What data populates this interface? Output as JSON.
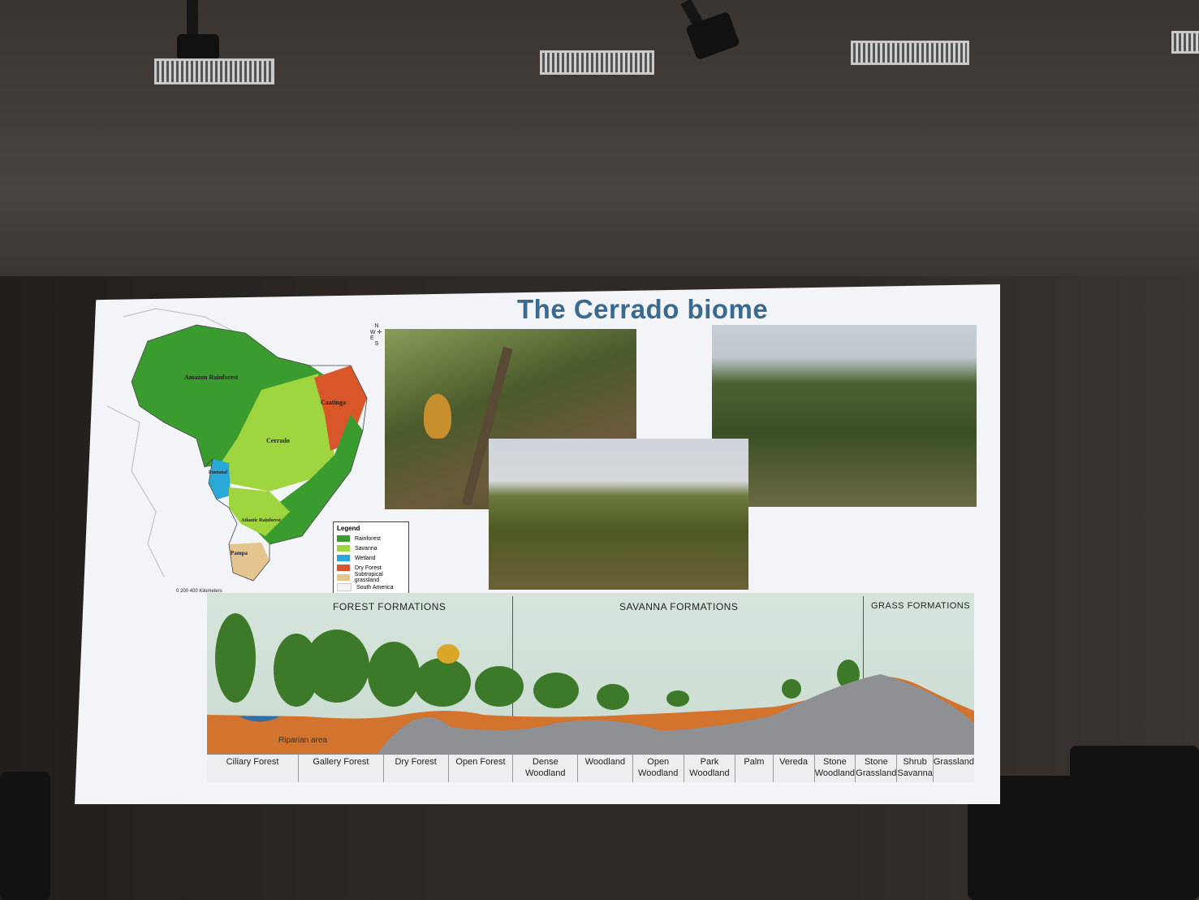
{
  "slide": {
    "title": "The Cerrado biome",
    "map": {
      "regions": [
        {
          "label": "Amazon Rainforest"
        },
        {
          "label": "Caatinga"
        },
        {
          "label": "Cerrado"
        },
        {
          "label": "Pantanal"
        },
        {
          "label": "Atlantic Rainforest"
        },
        {
          "label": "Pampa"
        }
      ],
      "compass": {
        "n": "N",
        "s": "S",
        "e": "E",
        "w": "W"
      },
      "scale": "0  200  400 Kilometers",
      "legend": {
        "title": "Legend",
        "items": [
          {
            "label": "Rainforest",
            "color": "#3a9b2e"
          },
          {
            "label": "Savanna",
            "color": "#9fd63f"
          },
          {
            "label": "Wetland",
            "color": "#2aa9d8"
          },
          {
            "label": "Dry Forest",
            "color": "#d9562a"
          },
          {
            "label": "Subtropical grassland",
            "color": "#e6c48e"
          },
          {
            "label": "South America",
            "color": "#f4f4f4"
          }
        ]
      }
    },
    "profile": {
      "groups": [
        "FOREST FORMATIONS",
        "SAVANNA FORMATIONS",
        "GRASS FORMATIONS"
      ],
      "riparian": "Riparian area",
      "formations": [
        "Ciliary Forest",
        "Gallery Forest",
        "Dry Forest",
        "Open Forest",
        "Dense Woodland",
        "Woodland",
        "Open Woodland",
        "Park Woodland",
        "Palm",
        "Vereda",
        "Stone Woodland",
        "Stone Grassland",
        "Shrub Savanna",
        "Grassland"
      ]
    }
  }
}
